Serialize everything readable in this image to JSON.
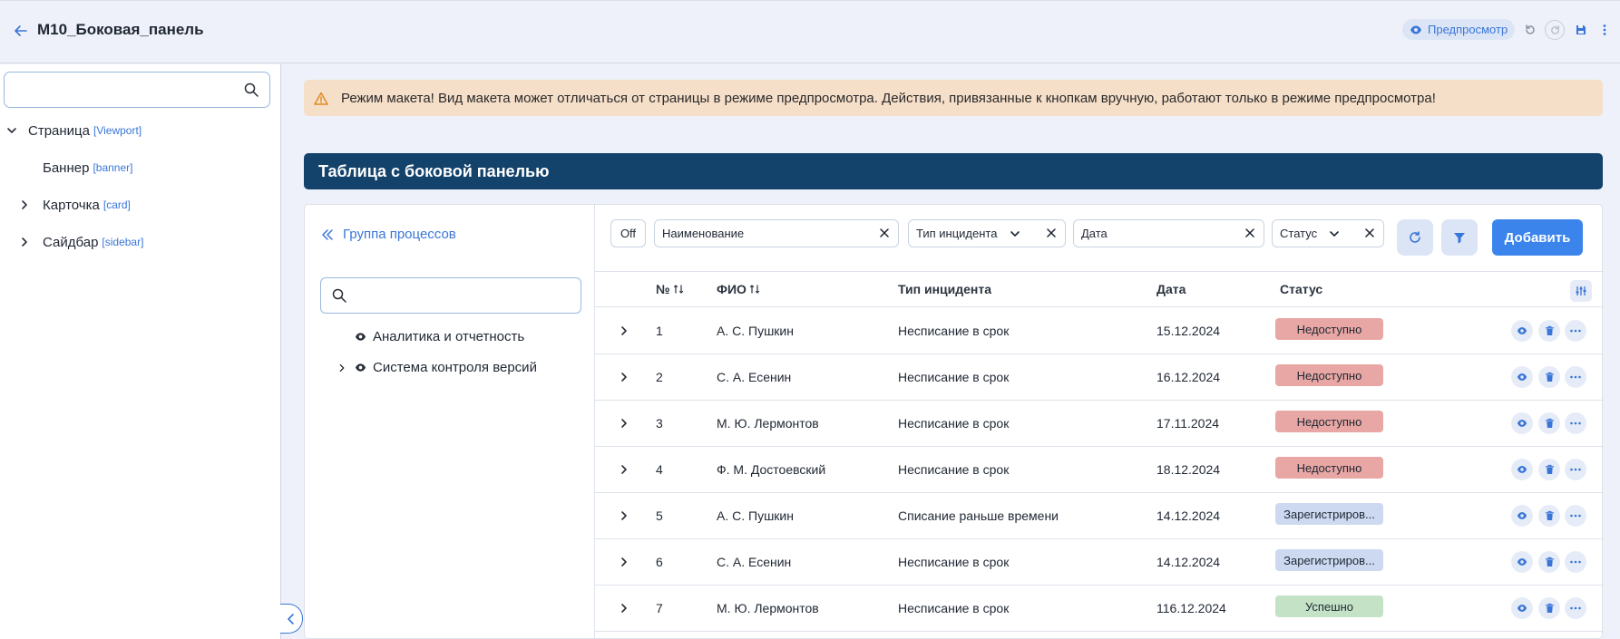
{
  "header": {
    "title": "М10_Боковая_панель",
    "preview_label": "Предпросмотр"
  },
  "tree": {
    "search_value": "",
    "items": [
      {
        "label": "Страница",
        "tag": "[Viewport]"
      },
      {
        "label": "Баннер",
        "tag": "[banner]"
      },
      {
        "label": "Карточка",
        "tag": "[card]"
      },
      {
        "label": "Сайдбар",
        "tag": "[sidebar]"
      }
    ]
  },
  "warning": {
    "text": "Режим макета! Вид макета может отличаться от страницы в режиме предпросмотра. Действия, привязанные к кнопкам вручную, работают только в режиме предпросмотра!"
  },
  "block": {
    "title": "Таблица с боковой панелью"
  },
  "side": {
    "header": "Группа процессов",
    "search_value": "",
    "items": [
      {
        "label": "Аналитика и отчетность"
      },
      {
        "label": "Система контроля версий"
      }
    ]
  },
  "filters": {
    "off_label": "Off",
    "name_label": "Наименование",
    "incident_label": "Тип инцидента",
    "date_label": "Дата",
    "status_label": "Статус",
    "add_label": "Добавить"
  },
  "table": {
    "columns": {
      "num": "№",
      "fio": "ФИО",
      "type": "Тип инцидента",
      "date": "Дата",
      "status": "Статус"
    },
    "rows": [
      {
        "num": "1",
        "fio": "А. С. Пушкин",
        "type": "Несписание в срок",
        "date": "15.12.2024",
        "status": "Недоступно"
      },
      {
        "num": "2",
        "fio": "С. А. Есенин",
        "type": "Несписание в срок",
        "date": "16.12.2024",
        "status": "Недоступно"
      },
      {
        "num": "3",
        "fio": "М. Ю. Лермонтов",
        "type": "Несписание в срок",
        "date": "17.11.2024",
        "status": "Недоступно"
      },
      {
        "num": "4",
        "fio": "Ф. М. Достоевский",
        "type": "Несписание в срок",
        "date": "18.12.2024",
        "status": "Недоступно"
      },
      {
        "num": "5",
        "fio": "А. С. Пушкин",
        "type": "Списание раньше времени",
        "date": "14.12.2024",
        "status": "Зарегистриров..."
      },
      {
        "num": "6",
        "fio": "С. А. Есенин",
        "type": "Несписание в срок",
        "date": "14.12.2024",
        "status": "Зарегистриров..."
      },
      {
        "num": "7",
        "fio": "М. Ю. Лермонтов",
        "type": "Несписание в срок",
        "date": "116.12.2024",
        "status": "Успешно"
      }
    ]
  },
  "colors": {
    "accent": "#3a76d8",
    "title_bar": "#13426b",
    "warning_bg": "#f6dfc9",
    "status_unavailable": "#e8a7a4",
    "status_registered": "#ccd9f0",
    "status_success": "#c4e2c6"
  }
}
